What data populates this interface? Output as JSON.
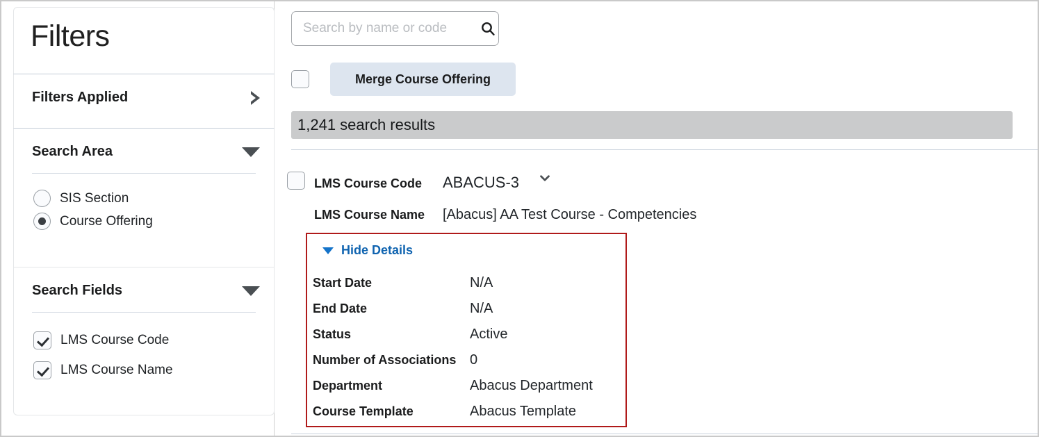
{
  "sidebar": {
    "title": "Filters",
    "sections": [
      {
        "title": "Filters Applied",
        "toggle_icon": "triangle-right-icon"
      },
      {
        "title": "Search Area",
        "toggle_icon": "triangle-down-icon"
      },
      {
        "title": "Search Fields",
        "toggle_icon": "triangle-down-icon"
      }
    ],
    "search_area_options": [
      {
        "label": "SIS Section",
        "selected": false
      },
      {
        "label": "Course Offering",
        "selected": true
      }
    ],
    "search_fields_options": [
      {
        "label": "LMS Course Code",
        "checked": true
      },
      {
        "label": "LMS Course Name",
        "checked": true
      }
    ]
  },
  "main": {
    "search": {
      "placeholder": "Search by name or code",
      "value": "",
      "icon": "search-icon"
    },
    "merge_button_label": "Merge Course Offering",
    "select_all_checked": false,
    "results_count_label": "1,241 search results",
    "result": {
      "checked": false,
      "code_label": "LMS Course Code",
      "code_value": "ABACUS-3",
      "expand_icon": "chevron-down-icon",
      "name_label": "LMS Course Name",
      "name_value": "[Abacus] AA Test Course - Competencies",
      "details_toggle_label": "Hide Details",
      "details_toggle_icon": "triangle-down-icon",
      "details": [
        {
          "key": "Start Date",
          "value": "N/A"
        },
        {
          "key": "End Date",
          "value": "N/A"
        },
        {
          "key": "Status",
          "value": "Active"
        },
        {
          "key": "Number of Associations",
          "value": "0"
        },
        {
          "key": "Department",
          "value": "Abacus Department"
        },
        {
          "key": "Course Template",
          "value": "Abacus Template"
        }
      ]
    }
  },
  "colors": {
    "highlight_box": "#b01a1a",
    "link": "#1064b0",
    "merge_button_bg": "#dde5ef",
    "results_bar_bg": "#cacbcc"
  }
}
